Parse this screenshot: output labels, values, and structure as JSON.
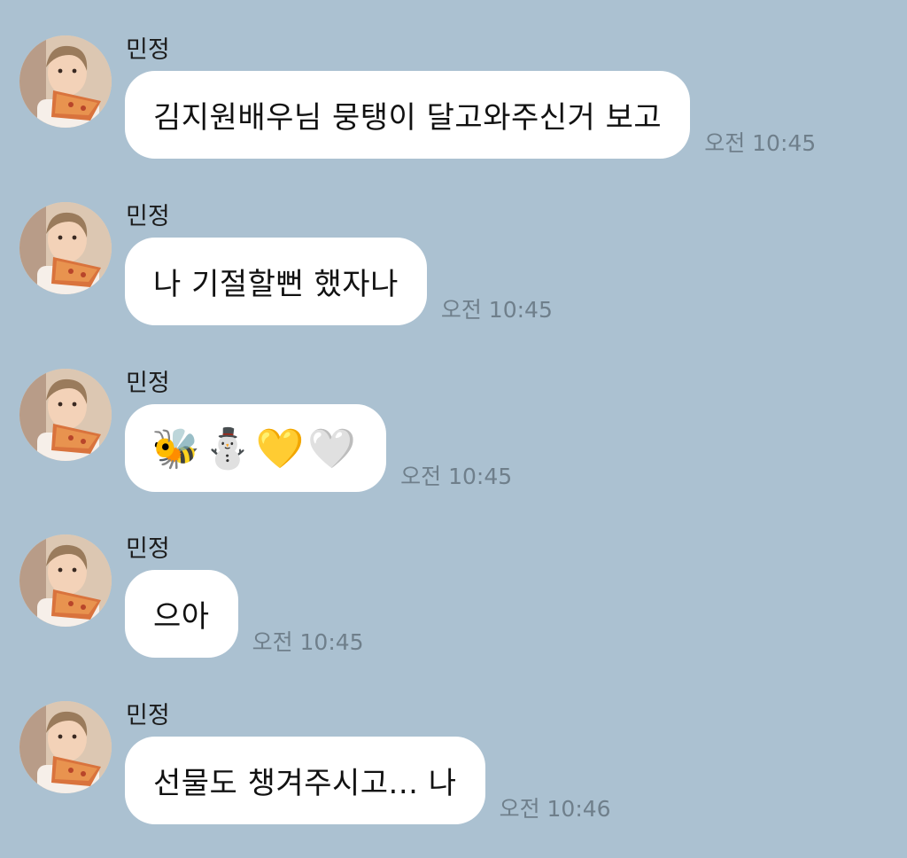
{
  "messages": [
    {
      "sender": "민정",
      "text": "김지원배우님 뭉탱이 달고와주신거 보고",
      "time": "오전 10:45"
    },
    {
      "sender": "민정",
      "text": "나 기절할뻔 했자나",
      "time": "오전 10:45"
    },
    {
      "sender": "민정",
      "text": "🐝⛄💛🤍",
      "time": "오전 10:45"
    },
    {
      "sender": "민정",
      "text": "으아",
      "time": "오전 10:45"
    },
    {
      "sender": "민정",
      "text": "선물도 챙겨주시고... 나",
      "time": "오전 10:46"
    }
  ],
  "colors": {
    "background": "#abc1d1",
    "bubble": "#ffffff",
    "timestamp": "#6f7f8b"
  },
  "icons": {
    "avatar": "profile-photo-child-eating-pizza"
  }
}
